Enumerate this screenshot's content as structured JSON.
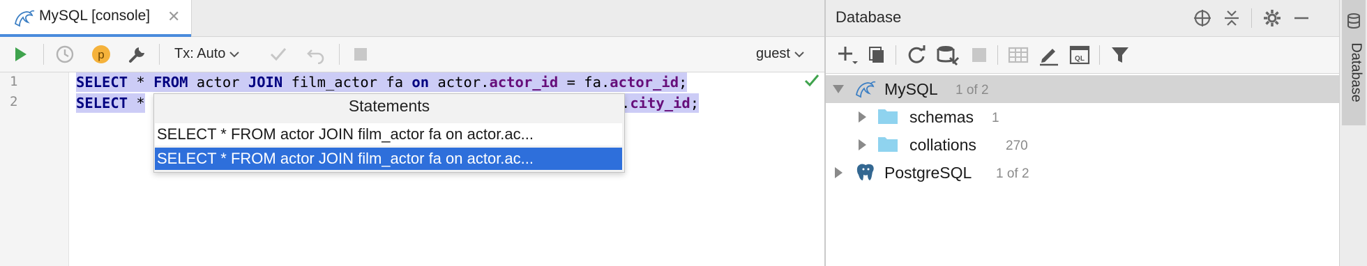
{
  "editor_tab": {
    "title": "MySQL [console]",
    "icon": "mysql-dolphin-icon"
  },
  "toolbar": {
    "tx_label": "Tx: Auto",
    "schema_badge": "p",
    "user_label": "guest",
    "icons": [
      "run-icon",
      "history-icon",
      "schema-badge-icon",
      "settings-wrench-icon",
      "commit-check-icon",
      "rollback-icon",
      "stop-icon"
    ]
  },
  "editor": {
    "line_numbers": [
      "1",
      "2"
    ],
    "lines": [
      [
        {
          "t": "SELECT",
          "c": "kw"
        },
        {
          "t": " * ",
          "c": "plain"
        },
        {
          "t": "FROM",
          "c": "kw"
        },
        {
          "t": " actor ",
          "c": "plain"
        },
        {
          "t": "JOIN",
          "c": "kw"
        },
        {
          "t": " film_actor fa ",
          "c": "plain"
        },
        {
          "t": "on",
          "c": "kw"
        },
        {
          "t": " actor.",
          "c": "plain"
        },
        {
          "t": "actor_id",
          "c": "col"
        },
        {
          "t": " = fa.",
          "c": "plain"
        },
        {
          "t": "actor_id",
          "c": "col"
        },
        {
          "t": ";",
          "c": "plain"
        }
      ],
      [
        {
          "t": "SELECT",
          "c": "kw"
        },
        {
          "t": " *",
          "c": "plain"
        }
      ],
      [
        {
          "t": ".",
          "c": "plain"
        },
        {
          "t": "city_id",
          "c": "col"
        },
        {
          "t": ";",
          "c": "plain"
        }
      ]
    ],
    "syntax_colors": {
      "keyword": "#000080",
      "column": "#660e7a",
      "selection": "#ccccf6"
    },
    "status_icon": "checkmark-icon"
  },
  "popup": {
    "header": "Statements",
    "items": [
      "SELECT * FROM actor JOIN film_actor fa on actor.ac...",
      "SELECT * FROM actor JOIN film_actor fa on actor.ac..."
    ],
    "selected_index": 1,
    "selection_color": "#2e6fdb"
  },
  "database_panel": {
    "title": "Database",
    "header_icons": [
      "crosshair-target-icon",
      "collapse-all-icon",
      "gear-icon",
      "minimize-icon"
    ],
    "toolbar_icons": [
      "add-icon",
      "duplicate-icon",
      "refresh-icon",
      "schema-sync-icon",
      "stop-icon",
      "table-icon",
      "edit-icon",
      "sql-console-icon",
      "filter-icon"
    ],
    "tree": [
      {
        "name": "MySQL",
        "count": "1 of 2",
        "icon": "mysql-dolphin-icon",
        "expanded": true,
        "selected": true
      },
      {
        "name": "schemas",
        "count": "1",
        "icon": "folder-icon",
        "expanded": false,
        "selected": false
      },
      {
        "name": "collations",
        "count": "270",
        "icon": "folder-icon",
        "expanded": false,
        "selected": false
      },
      {
        "name": "PostgreSQL",
        "count": "1 of 2",
        "icon": "postgresql-elephant-icon",
        "expanded": false,
        "selected": false
      }
    ]
  },
  "side_stripe": {
    "label": "Database",
    "icon": "database-icon"
  }
}
